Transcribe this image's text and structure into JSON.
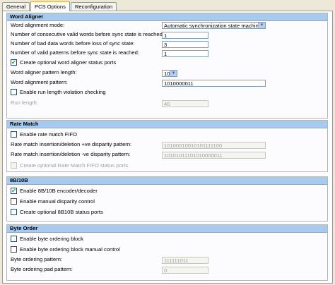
{
  "tabs": [
    "General",
    "PCS Options",
    "Reconfiguration"
  ],
  "word_aligner": {
    "title": "Word Aligner",
    "mode_label": "Word alignment mode:",
    "mode_value": "Automatic synchronization state machine",
    "consecutive_label": "Number of consecutive valid words before sync state is reached:",
    "consecutive_value": "1",
    "bad_label": "Number of bad data words before loss of sync state:",
    "bad_value": "3",
    "patterns_label": "Number of valid patterns before sync state is reached:",
    "patterns_value": "1",
    "status_ports_label": "Create optional word aligner status ports",
    "pattern_length_label": "Word aligner pattern length:",
    "pattern_length_value": "10",
    "pattern_label": "Word alignment pattern:",
    "pattern_value": "1010000011",
    "run_length_check_label": "Enable run length violation checking",
    "run_length_label": "Run length:",
    "run_length_value": "40"
  },
  "rate_match": {
    "title": "Rate Match",
    "fifo_label": "Enable rate match FIFO",
    "pos_label": "Rate match insertion/deletion +ve disparity pattern:",
    "pos_value": "10100010010101111100",
    "neg_label": "Rate match insertion/deletion -ve disparity pattern:",
    "neg_value": "10101011101010000011",
    "status_ports_label": "Create optional Rate Match FIFO status ports"
  },
  "enc8b10b": {
    "title": "8B/10B",
    "enable_label": "Enable 8B/10B encoder/decoder",
    "manual_label": "Enable manual disparity control",
    "status_ports_label": "Create optional 8B10B status ports"
  },
  "byte_order": {
    "title": "Byte Order",
    "enable_label": "Enable byte ordering block",
    "manual_label": "Enable byte ordering block manual control",
    "pattern_label": "Byte ordering pattern:",
    "pattern_value": "111111011",
    "pad_label": "Byte ordering pad pattern:",
    "pad_value": "0"
  },
  "check_glyph": "✔"
}
